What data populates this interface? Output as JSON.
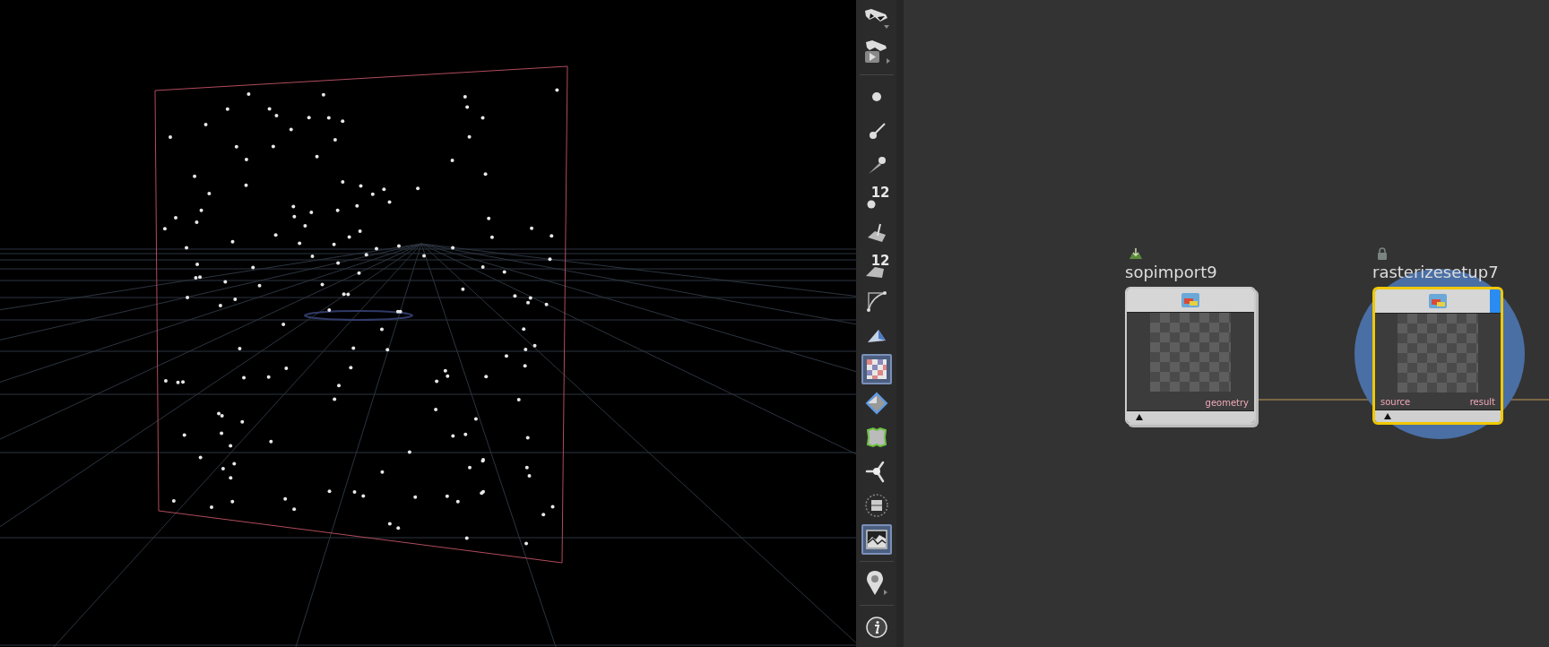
{
  "toolbar": [
    {
      "kind": "display-options",
      "selected": false
    },
    {
      "kind": "display-play",
      "selected": false
    },
    {
      "kind": "separator"
    },
    {
      "kind": "point",
      "selected": false
    },
    {
      "kind": "point-normal",
      "selected": false
    },
    {
      "kind": "point-brush",
      "selected": false
    },
    {
      "kind": "point-number",
      "selected": false,
      "label": "12"
    },
    {
      "kind": "prim-normal",
      "selected": false
    },
    {
      "kind": "prim-number",
      "selected": false,
      "label": "12"
    },
    {
      "kind": "curve",
      "selected": false
    },
    {
      "kind": "shaded-plane",
      "selected": false
    },
    {
      "kind": "checker",
      "selected": true
    },
    {
      "kind": "diamond",
      "selected": false
    },
    {
      "kind": "green-box",
      "selected": false
    },
    {
      "kind": "axis",
      "selected": false
    },
    {
      "kind": "circle-bars",
      "selected": false
    },
    {
      "kind": "image",
      "selected": true
    },
    {
      "kind": "separator"
    },
    {
      "kind": "pin",
      "selected": false
    },
    {
      "kind": "separator"
    },
    {
      "kind": "info",
      "selected": false
    }
  ],
  "network": {
    "nodes": [
      {
        "name": "sopimport9",
        "kind": "import",
        "selected": false,
        "outputs": [
          "geometry"
        ]
      },
      {
        "name": "rasterizesetup7",
        "kind": "locked",
        "selected": true,
        "inputs": [
          "source"
        ],
        "outputs": [
          "result"
        ]
      }
    ]
  }
}
